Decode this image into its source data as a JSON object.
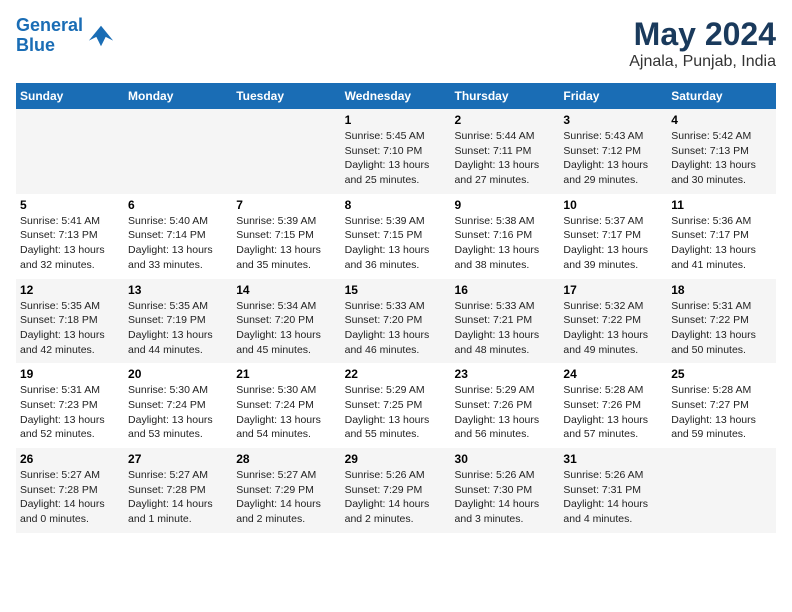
{
  "logo": {
    "line1": "General",
    "line2": "Blue"
  },
  "title": "May 2024",
  "location": "Ajnala, Punjab, India",
  "days_of_week": [
    "Sunday",
    "Monday",
    "Tuesday",
    "Wednesday",
    "Thursday",
    "Friday",
    "Saturday"
  ],
  "weeks": [
    [
      {
        "num": "",
        "info": ""
      },
      {
        "num": "",
        "info": ""
      },
      {
        "num": "",
        "info": ""
      },
      {
        "num": "1",
        "info": "Sunrise: 5:45 AM\nSunset: 7:10 PM\nDaylight: 13 hours\nand 25 minutes."
      },
      {
        "num": "2",
        "info": "Sunrise: 5:44 AM\nSunset: 7:11 PM\nDaylight: 13 hours\nand 27 minutes."
      },
      {
        "num": "3",
        "info": "Sunrise: 5:43 AM\nSunset: 7:12 PM\nDaylight: 13 hours\nand 29 minutes."
      },
      {
        "num": "4",
        "info": "Sunrise: 5:42 AM\nSunset: 7:13 PM\nDaylight: 13 hours\nand 30 minutes."
      }
    ],
    [
      {
        "num": "5",
        "info": "Sunrise: 5:41 AM\nSunset: 7:13 PM\nDaylight: 13 hours\nand 32 minutes."
      },
      {
        "num": "6",
        "info": "Sunrise: 5:40 AM\nSunset: 7:14 PM\nDaylight: 13 hours\nand 33 minutes."
      },
      {
        "num": "7",
        "info": "Sunrise: 5:39 AM\nSunset: 7:15 PM\nDaylight: 13 hours\nand 35 minutes."
      },
      {
        "num": "8",
        "info": "Sunrise: 5:39 AM\nSunset: 7:15 PM\nDaylight: 13 hours\nand 36 minutes."
      },
      {
        "num": "9",
        "info": "Sunrise: 5:38 AM\nSunset: 7:16 PM\nDaylight: 13 hours\nand 38 minutes."
      },
      {
        "num": "10",
        "info": "Sunrise: 5:37 AM\nSunset: 7:17 PM\nDaylight: 13 hours\nand 39 minutes."
      },
      {
        "num": "11",
        "info": "Sunrise: 5:36 AM\nSunset: 7:17 PM\nDaylight: 13 hours\nand 41 minutes."
      }
    ],
    [
      {
        "num": "12",
        "info": "Sunrise: 5:35 AM\nSunset: 7:18 PM\nDaylight: 13 hours\nand 42 minutes."
      },
      {
        "num": "13",
        "info": "Sunrise: 5:35 AM\nSunset: 7:19 PM\nDaylight: 13 hours\nand 44 minutes."
      },
      {
        "num": "14",
        "info": "Sunrise: 5:34 AM\nSunset: 7:20 PM\nDaylight: 13 hours\nand 45 minutes."
      },
      {
        "num": "15",
        "info": "Sunrise: 5:33 AM\nSunset: 7:20 PM\nDaylight: 13 hours\nand 46 minutes."
      },
      {
        "num": "16",
        "info": "Sunrise: 5:33 AM\nSunset: 7:21 PM\nDaylight: 13 hours\nand 48 minutes."
      },
      {
        "num": "17",
        "info": "Sunrise: 5:32 AM\nSunset: 7:22 PM\nDaylight: 13 hours\nand 49 minutes."
      },
      {
        "num": "18",
        "info": "Sunrise: 5:31 AM\nSunset: 7:22 PM\nDaylight: 13 hours\nand 50 minutes."
      }
    ],
    [
      {
        "num": "19",
        "info": "Sunrise: 5:31 AM\nSunset: 7:23 PM\nDaylight: 13 hours\nand 52 minutes."
      },
      {
        "num": "20",
        "info": "Sunrise: 5:30 AM\nSunset: 7:24 PM\nDaylight: 13 hours\nand 53 minutes."
      },
      {
        "num": "21",
        "info": "Sunrise: 5:30 AM\nSunset: 7:24 PM\nDaylight: 13 hours\nand 54 minutes."
      },
      {
        "num": "22",
        "info": "Sunrise: 5:29 AM\nSunset: 7:25 PM\nDaylight: 13 hours\nand 55 minutes."
      },
      {
        "num": "23",
        "info": "Sunrise: 5:29 AM\nSunset: 7:26 PM\nDaylight: 13 hours\nand 56 minutes."
      },
      {
        "num": "24",
        "info": "Sunrise: 5:28 AM\nSunset: 7:26 PM\nDaylight: 13 hours\nand 57 minutes."
      },
      {
        "num": "25",
        "info": "Sunrise: 5:28 AM\nSunset: 7:27 PM\nDaylight: 13 hours\nand 59 minutes."
      }
    ],
    [
      {
        "num": "26",
        "info": "Sunrise: 5:27 AM\nSunset: 7:28 PM\nDaylight: 14 hours\nand 0 minutes."
      },
      {
        "num": "27",
        "info": "Sunrise: 5:27 AM\nSunset: 7:28 PM\nDaylight: 14 hours\nand 1 minute."
      },
      {
        "num": "28",
        "info": "Sunrise: 5:27 AM\nSunset: 7:29 PM\nDaylight: 14 hours\nand 2 minutes."
      },
      {
        "num": "29",
        "info": "Sunrise: 5:26 AM\nSunset: 7:29 PM\nDaylight: 14 hours\nand 2 minutes."
      },
      {
        "num": "30",
        "info": "Sunrise: 5:26 AM\nSunset: 7:30 PM\nDaylight: 14 hours\nand 3 minutes."
      },
      {
        "num": "31",
        "info": "Sunrise: 5:26 AM\nSunset: 7:31 PM\nDaylight: 14 hours\nand 4 minutes."
      },
      {
        "num": "",
        "info": ""
      }
    ]
  ]
}
